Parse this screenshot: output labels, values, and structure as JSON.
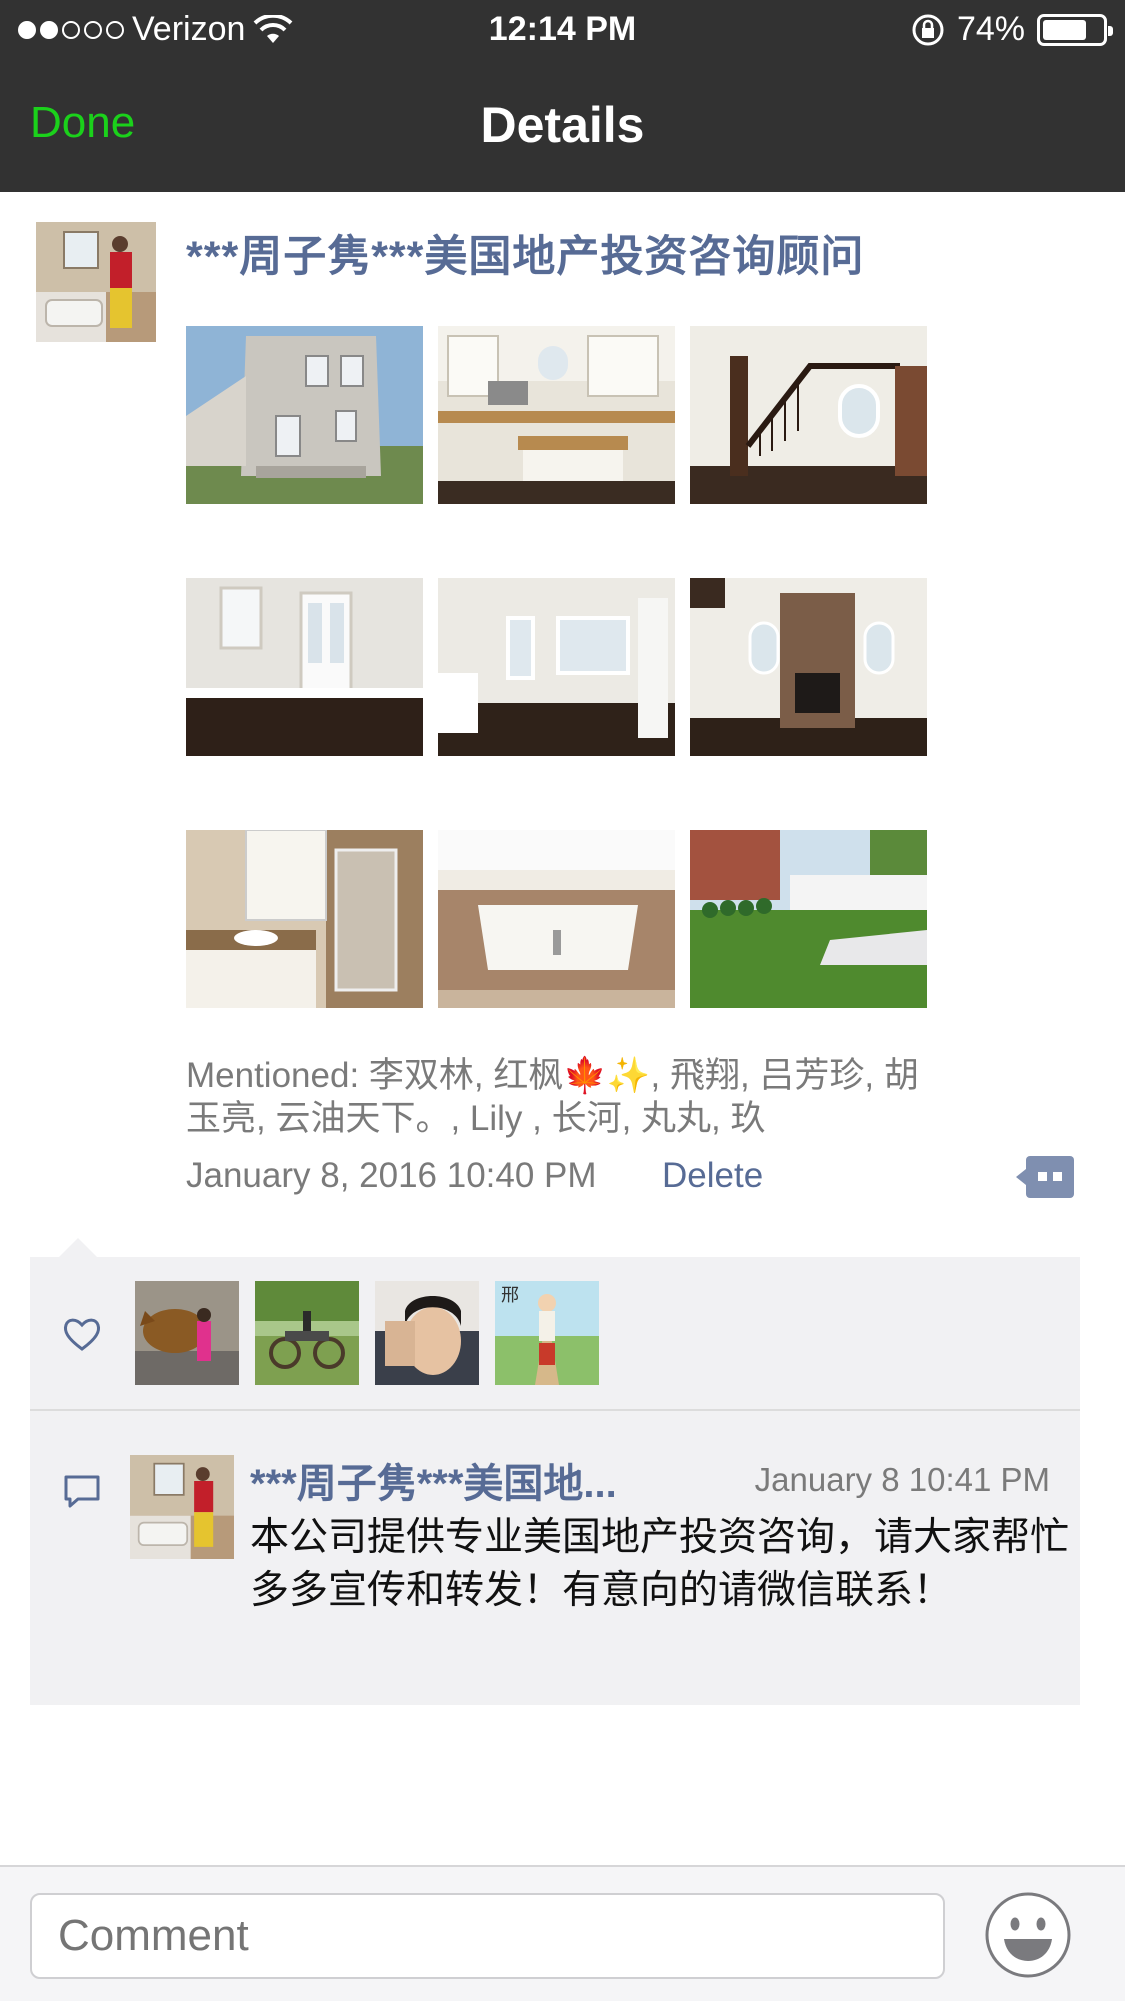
{
  "status_bar": {
    "carrier": "Verizon",
    "time": "12:14 PM",
    "battery": "74%",
    "battery_level": 0.74,
    "signal_dots_filled": 2,
    "signal_dots_total": 5
  },
  "nav": {
    "done_label": "Done",
    "title": "Details"
  },
  "post": {
    "author": "***周子隽***美国地产投资咨询顾问",
    "photos": [
      {
        "icon": "house-exterior"
      },
      {
        "icon": "kitchen"
      },
      {
        "icon": "staircase"
      },
      {
        "icon": "room-doors"
      },
      {
        "icon": "room-windows"
      },
      {
        "icon": "fireplace"
      },
      {
        "icon": "bathroom-shower"
      },
      {
        "icon": "bathtub"
      },
      {
        "icon": "backyard-lawn"
      }
    ],
    "mentioned": "Mentioned: 李双林, 红枫🍁✨, 飛翔, 吕芳珍, 胡玉亮, 云油天下。, Lily , 长河, 丸丸, 玖",
    "timestamp": "January 8, 2016 10:40 PM",
    "delete_label": "Delete"
  },
  "likes": {
    "users": [
      {
        "icon": "bull-statue-photo"
      },
      {
        "icon": "cannon-photo"
      },
      {
        "icon": "selfie-photo"
      },
      {
        "icon": "cartoon-photo"
      }
    ]
  },
  "comment": {
    "author": "***周子隽***美国地...",
    "time": "January 8 10:41 PM",
    "text": "本公司提供专业美国地产投资咨询，请大家帮忙多多宣传和转发！有意向的请微信联系！"
  },
  "input": {
    "placeholder": "Comment"
  },
  "colors": {
    "bar_bg": "#323232",
    "done_green": "#1bd11b",
    "link_blue": "#576b95",
    "panel_bg": "#f1f1f3"
  }
}
